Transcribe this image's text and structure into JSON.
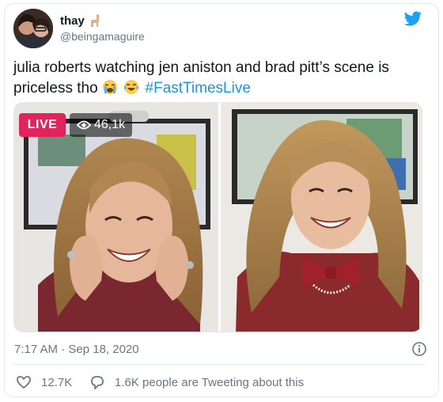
{
  "user": {
    "display_name": "thay",
    "handle": "@beingamaguire",
    "name_emoji": "llama-icon"
  },
  "tweet": {
    "text": "julia roberts watching jen aniston and brad pitt’s scene is priceless tho",
    "emojis": [
      "crying-face-icon",
      "tears-of-joy-icon"
    ],
    "hashtag": "#FastTimesLive"
  },
  "media": {
    "live_label": "LIVE",
    "viewer_count": "46,1k"
  },
  "meta": {
    "timestamp": "7:17 AM · Sep 18, 2020",
    "likes": "12.7K",
    "tweeting": "1.6K people are Tweeting about this"
  },
  "colors": {
    "link": "#1b95e0",
    "live": "#e0245e",
    "muted": "#657786"
  }
}
